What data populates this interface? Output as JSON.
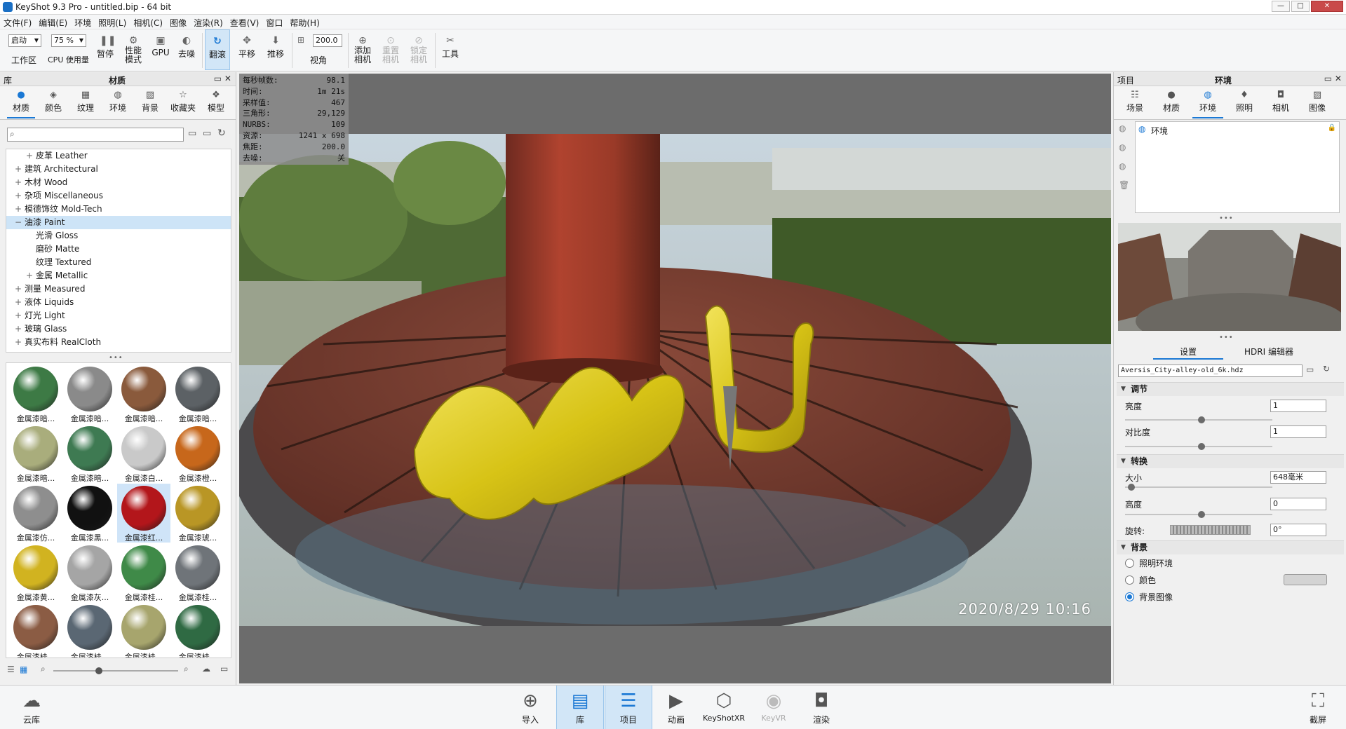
{
  "window": {
    "title": "KeyShot 9.3 Pro  - untitled.bip  - 64 bit",
    "controls": [
      "—",
      "□",
      "✕"
    ]
  },
  "menu": [
    "文件(F)",
    "编辑(E)",
    "环境",
    "照明(L)",
    "相机(C)",
    "图像",
    "渲染(R)",
    "查看(V)",
    "窗口",
    "帮助(H)"
  ],
  "toolbar": {
    "workspace_select": "启动",
    "workspace_label": "工作区",
    "cpu_select": "75 %",
    "cpu_label": "CPU 使用量",
    "pause": "暂停",
    "perf": "性能\n模式",
    "gpu": "GPU",
    "denoise": "去噪",
    "refresh": "翻滚",
    "pan": "平移",
    "push": "推移",
    "fov_value": "200.0",
    "fov_label": "视角",
    "add_camera": "添加\n相机",
    "reset_camera": "重置\n相机",
    "lock_camera": "锁定\n相机",
    "tools": "工具"
  },
  "left_panel": {
    "library_label": "库",
    "title": "材质",
    "tabs": [
      "材质",
      "颜色",
      "纹理",
      "环境",
      "背景",
      "收藏夹",
      "模型"
    ],
    "tree": [
      {
        "label": "皮革 Leather",
        "indent": 2,
        "exp": "+"
      },
      {
        "label": "建筑 Architectural",
        "indent": 1,
        "exp": "+"
      },
      {
        "label": "木材 Wood",
        "indent": 1,
        "exp": "+"
      },
      {
        "label": "杂项 Miscellaneous",
        "indent": 1,
        "exp": "+"
      },
      {
        "label": "模德饰纹 Mold-Tech",
        "indent": 1,
        "exp": "+"
      },
      {
        "label": "油漆 Paint",
        "indent": 1,
        "exp": "−",
        "selected": true
      },
      {
        "label": "光滑 Gloss",
        "indent": 2,
        "exp": ""
      },
      {
        "label": "磨砂 Matte",
        "indent": 2,
        "exp": ""
      },
      {
        "label": "纹理 Textured",
        "indent": 2,
        "exp": ""
      },
      {
        "label": "金属 Metallic",
        "indent": 2,
        "exp": "+"
      },
      {
        "label": "测量 Measured",
        "indent": 1,
        "exp": "+"
      },
      {
        "label": "液体 Liquids",
        "indent": 1,
        "exp": "+"
      },
      {
        "label": "灯光 Light",
        "indent": 1,
        "exp": "+"
      },
      {
        "label": "玻璃 Glass",
        "indent": 1,
        "exp": "+"
      },
      {
        "label": "真实布料 RealCloth",
        "indent": 1,
        "exp": "+"
      }
    ],
    "thumbs": [
      {
        "label": "金属漆暗...",
        "color": "#3d7a45"
      },
      {
        "label": "金属漆暗...",
        "color": "#8a8a8a"
      },
      {
        "label": "金属漆暗...",
        "color": "#8a5a3c"
      },
      {
        "label": "金属漆暗...",
        "color": "#5c6165"
      },
      {
        "label": "金属漆暗...",
        "color": "#a9ad7c"
      },
      {
        "label": "金属漆暗...",
        "color": "#3e7a52"
      },
      {
        "label": "金属漆白...",
        "color": "#c9c9c9"
      },
      {
        "label": "金属漆橙...",
        "color": "#c7671b"
      },
      {
        "label": "金属漆仿...",
        "color": "#8e8e8e"
      },
      {
        "label": "金属漆黑...",
        "color": "#111111"
      },
      {
        "label": "金属漆红...",
        "color": "#b3161b"
      },
      {
        "label": "金属漆琥...",
        "color": "#b99625"
      },
      {
        "label": "金属漆黄...",
        "color": "#d1b320"
      },
      {
        "label": "金属漆灰...",
        "color": "#a5a5a5"
      },
      {
        "label": "金属漆桂...",
        "color": "#3f8a48"
      },
      {
        "label": "金属漆桂...",
        "color": "#6f7479"
      },
      {
        "label": "金属漆桂...",
        "color": "#8b5c44"
      },
      {
        "label": "金属漆桂...",
        "color": "#5a6773"
      },
      {
        "label": "金属漆桂...",
        "color": "#a7a56d"
      },
      {
        "label": "金属漆桂...",
        "color": "#2f6a43"
      }
    ],
    "selected_thumb": 10
  },
  "hud": [
    {
      "k": "每秒帧数:",
      "v": "98.1"
    },
    {
      "k": "时间:",
      "v": "1m 21s"
    },
    {
      "k": "采样值:",
      "v": "467"
    },
    {
      "k": "三角形:",
      "v": "29,129"
    },
    {
      "k": "NURBS:",
      "v": "109"
    },
    {
      "k": "资源:",
      "v": "1241 x 698"
    },
    {
      "k": "焦距:",
      "v": "200.0"
    },
    {
      "k": "去噪:",
      "v": "关"
    }
  ],
  "viewport": {
    "datestamp": "2020/8/29  10:16"
  },
  "right_panel": {
    "project_label": "项目",
    "title": "环境",
    "tabs": [
      "场景",
      "材质",
      "环境",
      "照明",
      "相机",
      "图像"
    ],
    "env_item": "环境",
    "subtabs": [
      "设置",
      "HDRI 编辑器"
    ],
    "hdri_file": "Aversis_City-alley-old_6k.hdz",
    "sec_adjust": "调节",
    "brightness_label": "亮度",
    "brightness_value": "1",
    "brightness_level": 0.52,
    "contrast_label": "对比度",
    "contrast_value": "1",
    "contrast_level": 0.52,
    "sec_transform": "转换",
    "size_label": "大小",
    "size_value": "648毫米",
    "size_level": 0.02,
    "height_label": "高度",
    "height_value": "0",
    "height_level": 0.52,
    "rotation_label": "旋转:",
    "rotation_value": "0°",
    "sec_background": "背景",
    "bg_options": [
      "照明环境",
      "颜色",
      "背景图像"
    ],
    "bg_selected": 2
  },
  "bottom": {
    "cloud": "云库",
    "buttons": [
      "导入",
      "库",
      "项目",
      "动画",
      "KeyShotXR",
      "KeyVR",
      "渲染"
    ],
    "screenshot": "截屏"
  },
  "colors": {
    "accent": "#1a78d4",
    "selection": "#cde4f7"
  }
}
